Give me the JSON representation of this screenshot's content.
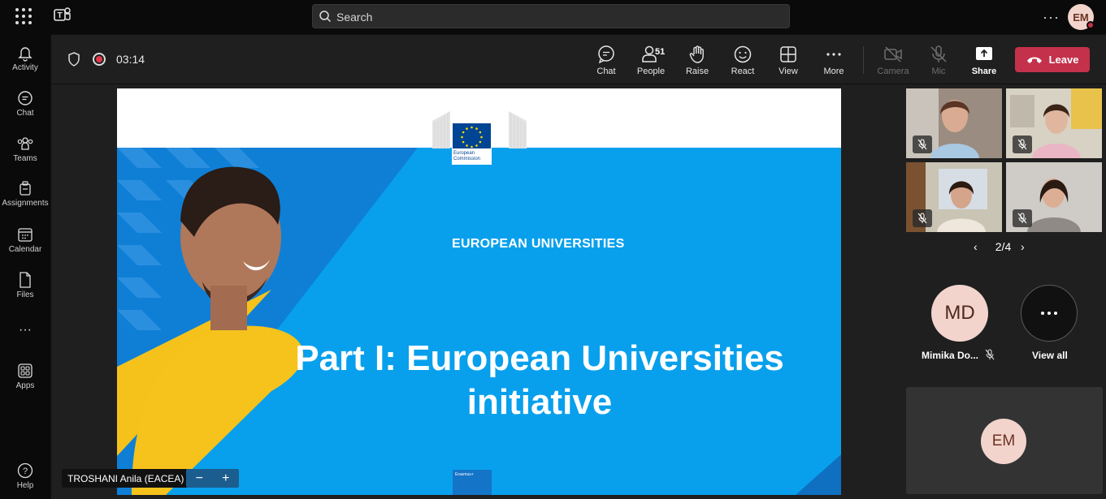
{
  "topbar": {
    "search_placeholder": "Search",
    "user_initials": "EM",
    "more_label": "···"
  },
  "rail": {
    "items": [
      {
        "label": "Activity",
        "icon": "bell-icon"
      },
      {
        "label": "Chat",
        "icon": "chat-icon"
      },
      {
        "label": "Teams",
        "icon": "teams-icon"
      },
      {
        "label": "Assignments",
        "icon": "assignments-icon"
      },
      {
        "label": "Calendar",
        "icon": "calendar-icon"
      },
      {
        "label": "Files",
        "icon": "file-icon"
      },
      {
        "label": "···",
        "icon": "more-icon"
      },
      {
        "label": "Apps",
        "icon": "apps-icon"
      },
      {
        "label": "Help",
        "icon": "help-icon"
      }
    ]
  },
  "meeting": {
    "timer": "03:14",
    "people_count": "51",
    "controls": {
      "chat": "Chat",
      "people": "People",
      "raise": "Raise",
      "react": "React",
      "view": "View",
      "more": "More",
      "camera": "Camera",
      "mic": "Mic",
      "share": "Share"
    },
    "leave_label": "Leave",
    "accent": "#c4314b"
  },
  "slide": {
    "logo_text_1": "European",
    "logo_text_2": "Commission",
    "heading": "EUROPEAN UNIVERSITIES",
    "title": "Part I: European Universities initiative",
    "footer_badge": "Erasmus+",
    "background_color": "#08a0ec"
  },
  "presenter": {
    "name": "TROSHANI Anila (EACEA)",
    "zoom_out": "−",
    "zoom_in": "+"
  },
  "side": {
    "pager": "2/4",
    "prev": "‹",
    "next": "›",
    "participant_initials": "MD",
    "participant_name": "Mimika Do...",
    "view_all_label": "View all",
    "self_initials": "EM"
  }
}
